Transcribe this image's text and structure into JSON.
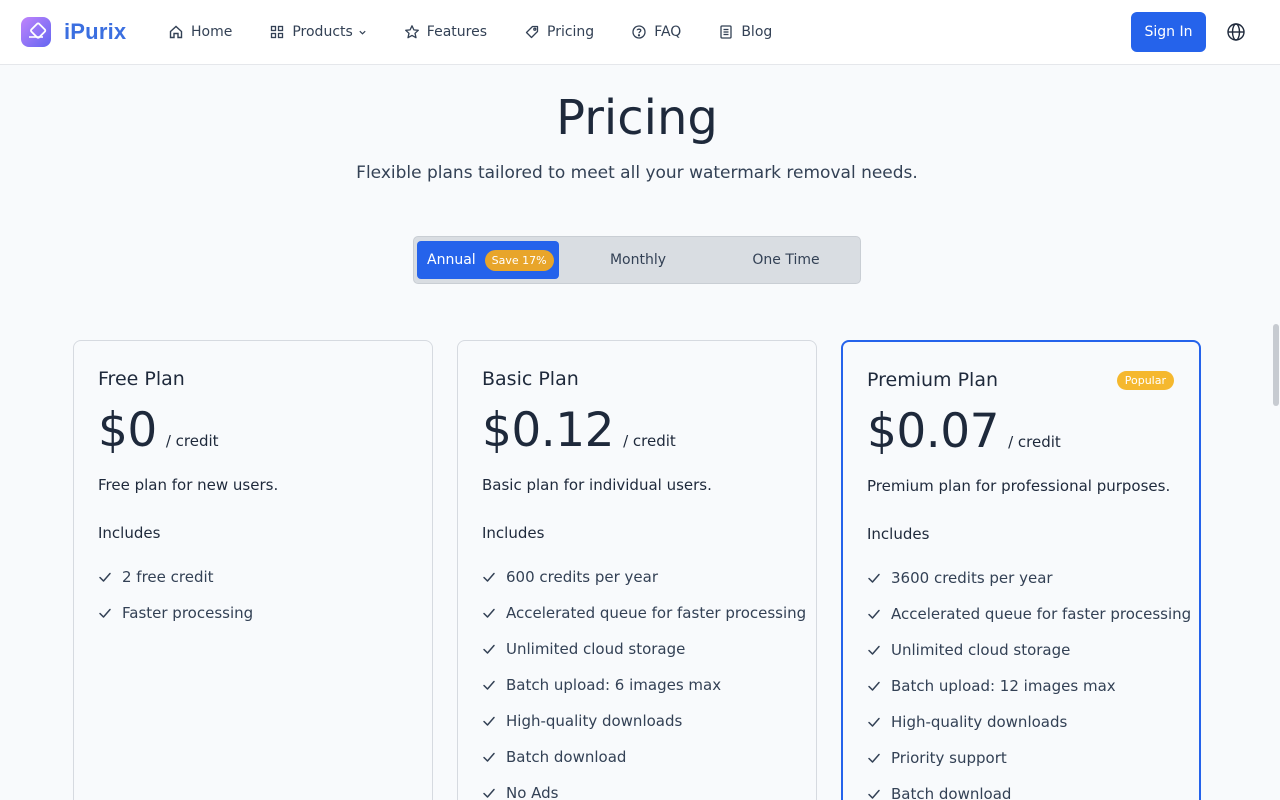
{
  "nav": {
    "brand": "iPurix",
    "items": [
      {
        "label": "Home",
        "icon": "home-icon"
      },
      {
        "label": "Products",
        "icon": "grid-icon"
      },
      {
        "label": "Features",
        "icon": "star-icon"
      },
      {
        "label": "Pricing",
        "icon": "tag-icon"
      },
      {
        "label": "FAQ",
        "icon": "help-circle-icon"
      },
      {
        "label": "Blog",
        "icon": "document-icon"
      }
    ],
    "signin_label": "Sign In",
    "accent_color": "#2563eb"
  },
  "header": {
    "title": "Pricing",
    "subtitle": "Flexible plans tailored to meet all your watermark removal needs."
  },
  "billing_toggle": {
    "options": [
      "Annual",
      "Monthly",
      "One Time"
    ],
    "selected": "Annual",
    "save_badge": "Save 17%"
  },
  "plans": [
    {
      "name": "Free Plan",
      "price": "$0",
      "unit": "/ credit",
      "description": "Free plan for new users.",
      "includes_label": "Includes",
      "features": [
        "2 free credit",
        "Faster processing"
      ]
    },
    {
      "name": "Basic Plan",
      "price": "$0.12",
      "unit": "/ credit",
      "description": "Basic plan for individual users.",
      "includes_label": "Includes",
      "features": [
        "600 credits per year",
        "Accelerated queue for faster processing",
        "Unlimited cloud storage",
        "Batch upload: 6 images max",
        "High-quality downloads",
        "Batch download",
        "No Ads"
      ]
    },
    {
      "name": "Premium Plan",
      "price": "$0.07",
      "unit": "/ credit",
      "description": "Premium plan for professional purposes.",
      "includes_label": "Includes",
      "badge": "Popular",
      "features": [
        "3600 credits per year",
        "Accelerated queue for faster processing",
        "Unlimited cloud storage",
        "Batch upload: 12 images max",
        "High-quality downloads",
        "Priority support",
        "Batch download"
      ]
    }
  ]
}
